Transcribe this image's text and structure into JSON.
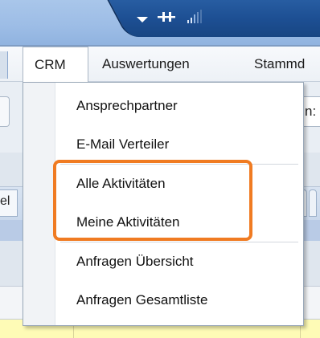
{
  "titlebar": {
    "icons": [
      "dropdown-arrow-icon",
      "pin-icon",
      "signal-icon"
    ]
  },
  "menubar": {
    "items": [
      {
        "label": "CRM"
      },
      {
        "label": "Auswertungen"
      },
      {
        "label": "Stammd"
      }
    ]
  },
  "background": {
    "toolbar_fragment": "n:",
    "tab_fragment": "el",
    "grid_fragment": "."
  },
  "dropdown": {
    "items": [
      {
        "label": "Ansprechpartner"
      },
      {
        "label": "E-Mail Verteiler"
      },
      {
        "label": "Alle Aktivitäten"
      },
      {
        "label": "Meine Aktivitäten"
      },
      {
        "label": "Anfragen Übersicht"
      },
      {
        "label": "Anfragen Gesamtliste"
      }
    ]
  },
  "colors": {
    "highlight": "#f07b22",
    "titlebar_dark": "#1d4f93",
    "yellow_row": "#fefbb6"
  }
}
